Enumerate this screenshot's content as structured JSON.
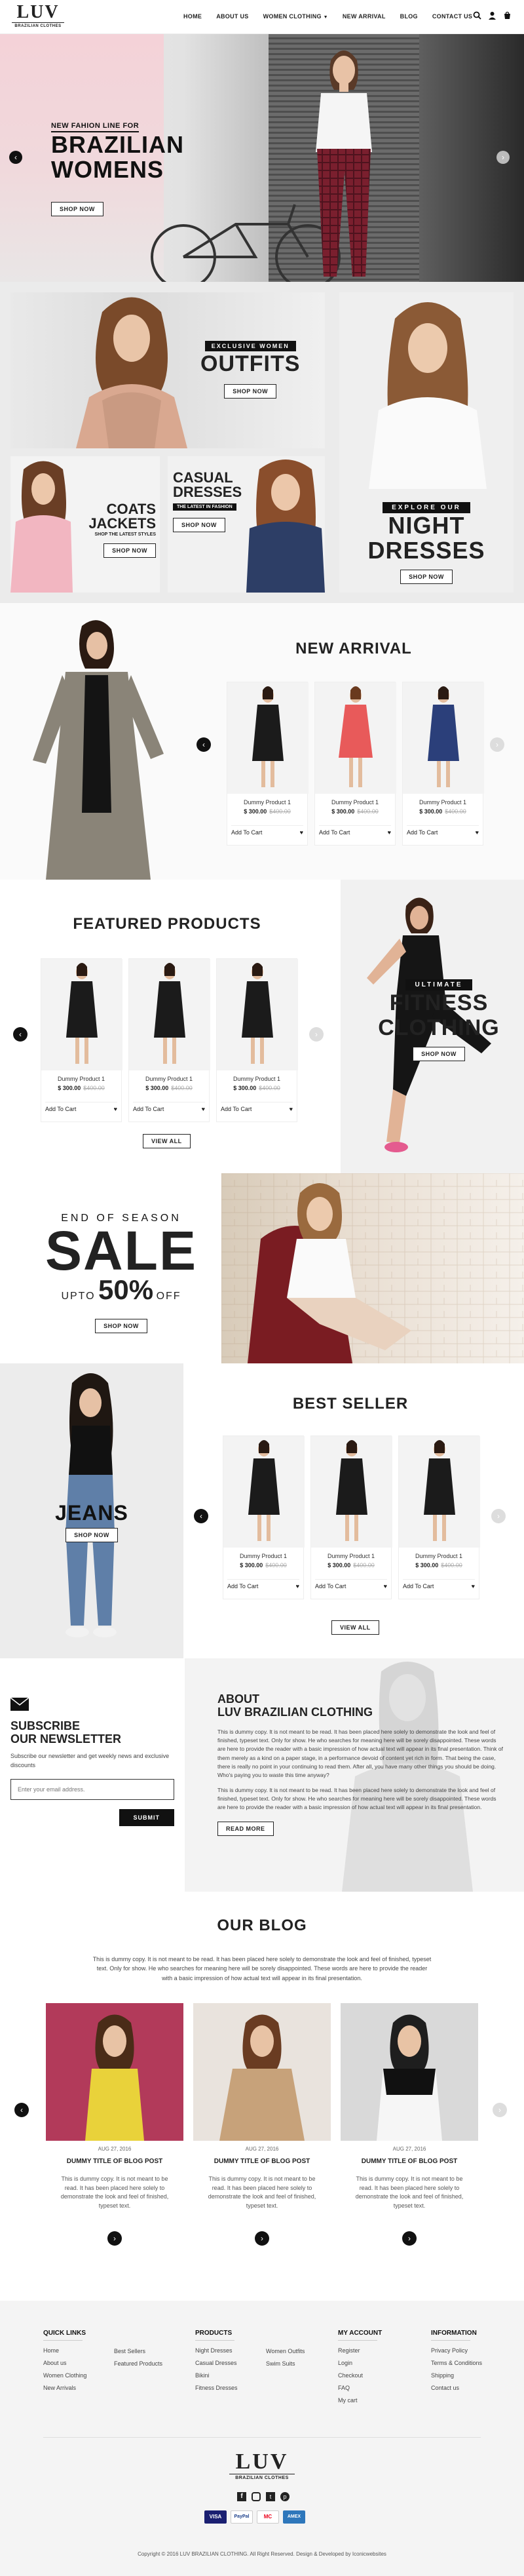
{
  "header": {
    "logo_text": "LUV",
    "logo_sub": "BRAZILIAN CLOTHES",
    "nav": [
      "HOME",
      "ABOUT US",
      "WOMEN CLOTHING",
      "NEW ARRIVAL",
      "BLOG",
      "CONTACT US"
    ],
    "icons": [
      "search-icon",
      "user-icon",
      "cart-icon"
    ]
  },
  "hero": {
    "kicker": "NEW FAHION LINE FOR",
    "title_line1": "BRAZILIAN",
    "title_line2": "WOMENS",
    "button": "SHOP NOW"
  },
  "promos": {
    "outfits": {
      "kicker": "EXCLUSIVE WOMEN",
      "title": "OUTFITS",
      "button": "SHOP NOW"
    },
    "coats": {
      "title_line1": "COATS",
      "title_line2": "JACKETS",
      "sub": "SHOP THE LATEST STYLES",
      "button": "SHOP NOW"
    },
    "casual": {
      "title_line1": "CASUAL",
      "title_line2": "DRESSES",
      "sub": "THE LATEST IN FASHION",
      "button": "SHOP NOW"
    },
    "night": {
      "kicker": "EXPLORE OUR",
      "title_line1": "NIGHT",
      "title_line2": "DRESSES",
      "button": "SHOP NOW"
    }
  },
  "new_arrival": {
    "heading": "NEW ARRIVAL",
    "products": [
      {
        "name": "Dummy Product 1",
        "price": "$ 300.00",
        "old": "$400.00",
        "cta": "Add To Cart"
      },
      {
        "name": "Dummy Product 1",
        "price": "$ 300.00",
        "old": "$400.00",
        "cta": "Add To Cart"
      },
      {
        "name": "Dummy Product 1",
        "price": "$ 300.00",
        "old": "$400.00",
        "cta": "Add To Cart"
      }
    ]
  },
  "featured": {
    "heading": "FEATURED PRODUCTS",
    "products": [
      {
        "name": "Dummy Product 1",
        "price": "$ 300.00",
        "old": "$400.00",
        "cta": "Add To Cart"
      },
      {
        "name": "Dummy Product 1",
        "price": "$ 300.00",
        "old": "$400.00",
        "cta": "Add To Cart"
      },
      {
        "name": "Dummy Product 1",
        "price": "$ 300.00",
        "old": "$400.00",
        "cta": "Add To Cart"
      }
    ],
    "view_all": "VIEW ALL",
    "fitness": {
      "kicker": "ULTIMATE",
      "title_line1": "FITNESS",
      "title_line2": "CLOTHING",
      "button": "SHOP NOW"
    }
  },
  "sale": {
    "kicker": "END OF SEASON",
    "title": "SALE",
    "upto": "UPTO",
    "percent": "50%",
    "off": "OFF",
    "button": "SHOP NOW"
  },
  "best_seller": {
    "heading": "BEST SELLER",
    "jeans_title": "JEANS",
    "jeans_button": "SHOP NOW",
    "products": [
      {
        "name": "Dummy Product 1",
        "price": "$ 300.00",
        "old": "$400.00",
        "cta": "Add To Cart"
      },
      {
        "name": "Dummy Product 1",
        "price": "$ 300.00",
        "old": "$400.00",
        "cta": "Add To Cart"
      },
      {
        "name": "Dummy Product 1",
        "price": "$ 300.00",
        "old": "$400.00",
        "cta": "Add To Cart"
      }
    ],
    "view_all": "VIEW ALL"
  },
  "newsletter": {
    "title_line1": "SUBSCRIBE",
    "title_line2": "OUR NEWSLETTER",
    "desc": "Subscribe our newsletter and get weekly news and exclusive discounts",
    "placeholder": "Enter your email address.",
    "button": "SUBMIT"
  },
  "about": {
    "title_line1": "ABOUT",
    "title_line2": "LUV BRAZILIAN CLOTHING",
    "para1": "This is dummy copy. It is not meant to be read. It has been placed here solely to demonstrate the look and feel of finished, typeset text. Only for show. He who searches for meaning here will be sorely disappointed. These words are here to provide the reader with a basic impression of how actual text will appear in its final presentation. Think of them merely as a kind on a paper stage, in a performance devoid of content yet rich in form. That being the case, there is really no point in your continuing to read them. After all, you have many other things you should be doing. Who's paying you to waste this time anyway?",
    "para2": "This is dummy copy. It is not meant to be read. It has been placed here solely to demonstrate the look and feel of finished, typeset text. Only for show. He who searches for meaning here will be sorely disappointed. These words are here to provide the reader with a basic impression of how actual text will appear in its final presentation.",
    "button": "READ MORE"
  },
  "blog": {
    "heading": "OUR BLOG",
    "intro": "This is dummy copy. It is not meant to be read. It has been placed here solely to demonstrate the look and feel of finished, typeset text. Only for show. He who searches for meaning here will be sorely disappointed. These words are here to provide the reader with a basic impression of how actual text will appear in its final presentation.",
    "posts": [
      {
        "date": "AUG 27, 2016",
        "title": "DUMMY TITLE OF BLOG POST",
        "desc": "This is dummy copy. It is not meant to be read. It has been placed here solely to demonstrate the look and feel of finished, typeset text."
      },
      {
        "date": "AUG 27, 2016",
        "title": "DUMMY TITLE OF BLOG POST",
        "desc": "This is dummy copy. It is not meant to be read. It has been placed here solely to demonstrate the look and feel of finished, typeset text."
      },
      {
        "date": "AUG 27, 2016",
        "title": "DUMMY TITLE OF BLOG POST",
        "desc": "This is dummy copy. It is not meant to be read. It has been placed here solely to demonstrate the look and feel of finished, typeset text."
      }
    ]
  },
  "footer": {
    "cols": [
      {
        "title": "QUICK LINKS",
        "links": [
          "Home",
          "About us",
          "Women Clothing",
          "New Arrivals"
        ]
      },
      {
        "title": "",
        "links": [
          "Best Sellers",
          "Featured Products"
        ]
      },
      {
        "title": "PRODUCTS",
        "links": [
          "Night Dresses",
          "Casual Dresses",
          "Bikini",
          "Fitness Dresses"
        ]
      },
      {
        "title": "",
        "links": [
          "Women Outfits",
          "Swim Suits"
        ]
      },
      {
        "title": "MY ACCOUNT",
        "links": [
          "Register",
          "Login",
          "Checkout",
          "FAQ",
          "My cart"
        ]
      },
      {
        "title": "INFORMATION",
        "links": [
          "Privacy Policy",
          "Terms & Conditions",
          "Shipping",
          "Contact us"
        ]
      }
    ],
    "logo_text": "LUV",
    "logo_sub": "BRAZILIAN CLOTHES",
    "social": [
      "facebook-icon",
      "instagram-icon",
      "twitter-icon",
      "pinterest-icon"
    ],
    "payments": [
      "VISA",
      "PayPal",
      "MC",
      "AMEX"
    ],
    "copyright": "Copyright © 2016 LUV BRAZILIAN CLOTHING. All Right Reserved. Design & Developed by Iconicwebsites"
  },
  "colors": {
    "dark": "#111111",
    "light_bg": "#f4f4f4",
    "accent_pink": "#f3cbd3",
    "sale_red": "#111111"
  }
}
